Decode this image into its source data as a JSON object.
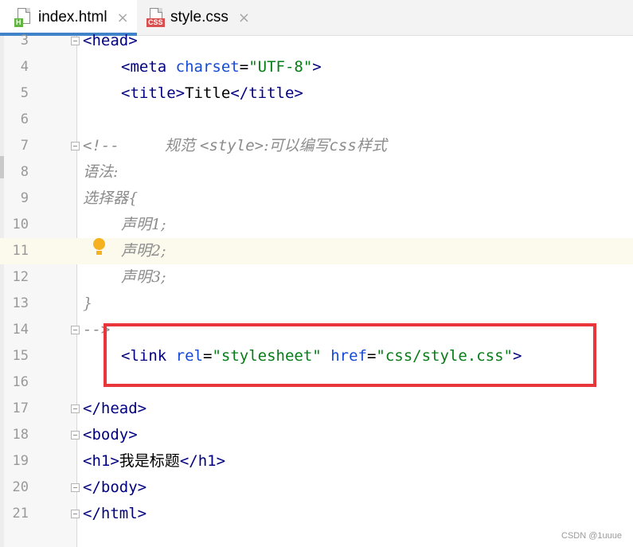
{
  "tabs": [
    {
      "label": "index.html",
      "icon": "html-file-icon",
      "badge": "H",
      "active": true
    },
    {
      "label": "style.css",
      "icon": "css-file-icon",
      "badge": "CSS",
      "active": false
    }
  ],
  "close_glyph": "×",
  "colors": {
    "tag": "#000080",
    "attr": "#174ad4",
    "value": "#067d17",
    "comment": "#8c8c8c",
    "highlight_box": "#e8363a",
    "current_line": "#fcfaed"
  },
  "lines": [
    {
      "num": "3",
      "parts": [
        {
          "t": "<",
          "c": "tag"
        },
        {
          "t": "head",
          "c": "tag"
        },
        {
          "t": ">",
          "c": "tag"
        }
      ],
      "indent": 0
    },
    {
      "num": "4",
      "parts": [
        {
          "t": "<",
          "c": "tag"
        },
        {
          "t": "meta",
          "c": "tag"
        },
        {
          "t": " "
        },
        {
          "t": "charset",
          "c": "attr"
        },
        {
          "t": "="
        },
        {
          "t": "\"UTF-8\"",
          "c": "val"
        },
        {
          "t": ">",
          "c": "tag"
        }
      ],
      "indent": 1
    },
    {
      "num": "5",
      "parts": [
        {
          "t": "<",
          "c": "tag"
        },
        {
          "t": "title",
          "c": "tag"
        },
        {
          "t": ">",
          "c": "tag"
        },
        {
          "t": "Title"
        },
        {
          "t": "</",
          "c": "tag"
        },
        {
          "t": "title",
          "c": "tag"
        },
        {
          "t": ">",
          "c": "tag"
        }
      ],
      "indent": 1
    },
    {
      "num": "6",
      "parts": [],
      "indent": 0
    },
    {
      "num": "7",
      "parts": [
        {
          "t": "<!--     ",
          "c": "cmtm"
        },
        {
          "t": "规范 ",
          "c": "cmt"
        },
        {
          "t": "<style>",
          "c": "cmtm"
        },
        {
          "t": ":可以编写",
          "c": "cmt"
        },
        {
          "t": "css",
          "c": "cmtm"
        },
        {
          "t": "样式",
          "c": "cmt"
        }
      ],
      "indent": 0
    },
    {
      "num": "8",
      "parts": [
        {
          "t": "语法:",
          "c": "cmt"
        }
      ],
      "indent": 0
    },
    {
      "num": "9",
      "parts": [
        {
          "t": "选择器{",
          "c": "cmt"
        }
      ],
      "indent": 0
    },
    {
      "num": "10",
      "parts": [
        {
          "t": "声明1;",
          "c": "cmt"
        }
      ],
      "indent": 1
    },
    {
      "num": "11",
      "parts": [
        {
          "t": "声明2;",
          "c": "cmt"
        }
      ],
      "indent": 1
    },
    {
      "num": "12",
      "parts": [
        {
          "t": "声明3;",
          "c": "cmt"
        }
      ],
      "indent": 1
    },
    {
      "num": "13",
      "parts": [
        {
          "t": "}",
          "c": "cmt"
        }
      ],
      "indent": 0
    },
    {
      "num": "14",
      "parts": [
        {
          "t": "-->",
          "c": "cmtm"
        }
      ],
      "indent": 0
    },
    {
      "num": "15",
      "parts": [
        {
          "t": "<",
          "c": "tag"
        },
        {
          "t": "link",
          "c": "tag"
        },
        {
          "t": " "
        },
        {
          "t": "rel",
          "c": "attr"
        },
        {
          "t": "="
        },
        {
          "t": "\"stylesheet\"",
          "c": "val"
        },
        {
          "t": " "
        },
        {
          "t": "href",
          "c": "attr"
        },
        {
          "t": "="
        },
        {
          "t": "\"css/style.css\"",
          "c": "val"
        },
        {
          "t": ">",
          "c": "tag"
        }
      ],
      "indent": 1
    },
    {
      "num": "16",
      "parts": [],
      "indent": 0
    },
    {
      "num": "17",
      "parts": [
        {
          "t": "</",
          "c": "tag"
        },
        {
          "t": "head",
          "c": "tag"
        },
        {
          "t": ">",
          "c": "tag"
        }
      ],
      "indent": 0
    },
    {
      "num": "18",
      "parts": [
        {
          "t": "<",
          "c": "tag"
        },
        {
          "t": "body",
          "c": "tag"
        },
        {
          "t": ">",
          "c": "tag"
        }
      ],
      "indent": 0
    },
    {
      "num": "19",
      "parts": [
        {
          "t": "<",
          "c": "tag"
        },
        {
          "t": "h1",
          "c": "tag"
        },
        {
          "t": ">",
          "c": "tag"
        },
        {
          "t": "我是标题"
        },
        {
          "t": "</",
          "c": "tag"
        },
        {
          "t": "h1",
          "c": "tag"
        },
        {
          "t": ">",
          "c": "tag"
        }
      ],
      "indent": 0
    },
    {
      "num": "20",
      "parts": [
        {
          "t": "</",
          "c": "tag"
        },
        {
          "t": "body",
          "c": "tag"
        },
        {
          "t": ">",
          "c": "tag"
        }
      ],
      "indent": 0
    },
    {
      "num": "21",
      "parts": [
        {
          "t": "</",
          "c": "tag"
        },
        {
          "t": "html",
          "c": "tag"
        },
        {
          "t": ">",
          "c": "tag"
        }
      ],
      "indent": 0
    }
  ],
  "current_line": "11",
  "fold_lines": [
    "3",
    "7",
    "14",
    "17",
    "18",
    "20",
    "21"
  ],
  "watermark": "CSDN @1uuue"
}
